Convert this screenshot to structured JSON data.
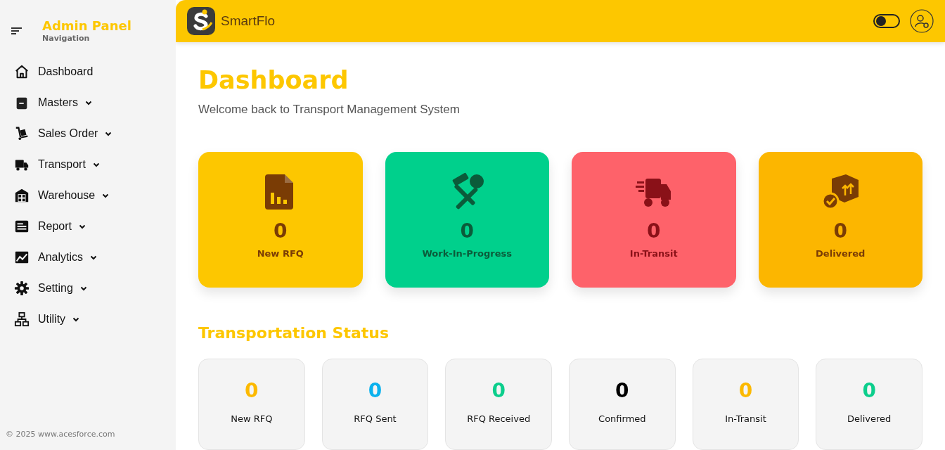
{
  "sidebar": {
    "title": "Admin Panel",
    "subtitle": "Navigation",
    "items": [
      {
        "label": "Dashboard",
        "expandable": false
      },
      {
        "label": "Masters",
        "expandable": true
      },
      {
        "label": "Sales Order",
        "expandable": true
      },
      {
        "label": "Transport",
        "expandable": true
      },
      {
        "label": "Warehouse",
        "expandable": true
      },
      {
        "label": "Report",
        "expandable": true
      },
      {
        "label": "Analytics",
        "expandable": true
      },
      {
        "label": "Setting",
        "expandable": true
      },
      {
        "label": "Utility",
        "expandable": true
      }
    ],
    "footer": "© 2025 www.acesforce.com"
  },
  "header": {
    "brand": "SmartFlo",
    "theme_toggle": {
      "on": false
    }
  },
  "page": {
    "title": "Dashboard",
    "subtitle": "Welcome back to Transport Management System"
  },
  "summary_cards": [
    {
      "value": "0",
      "label": "New RFQ",
      "color": "#fdc700"
    },
    {
      "value": "0",
      "label": "Work-In-Progress",
      "color": "#00d08c"
    },
    {
      "value": "0",
      "label": "In-Transit",
      "color": "#fe626a"
    },
    {
      "value": "0",
      "label": "Delivered",
      "color": "#fcb600"
    }
  ],
  "transportation_status": {
    "title": "Transportation Status",
    "items": [
      {
        "value": "0",
        "label": "New RFQ",
        "color": "#fcb900"
      },
      {
        "value": "0",
        "label": "RFQ Sent",
        "color": "#0bb2ee"
      },
      {
        "value": "0",
        "label": "RFQ Received",
        "color": "#0cce8c"
      },
      {
        "value": "0",
        "label": "Confirmed",
        "color": "#000000"
      },
      {
        "value": "0",
        "label": "In-Transit",
        "color": "#fcb900"
      },
      {
        "value": "0",
        "label": "Delivered",
        "color": "#0cce8c"
      }
    ]
  }
}
